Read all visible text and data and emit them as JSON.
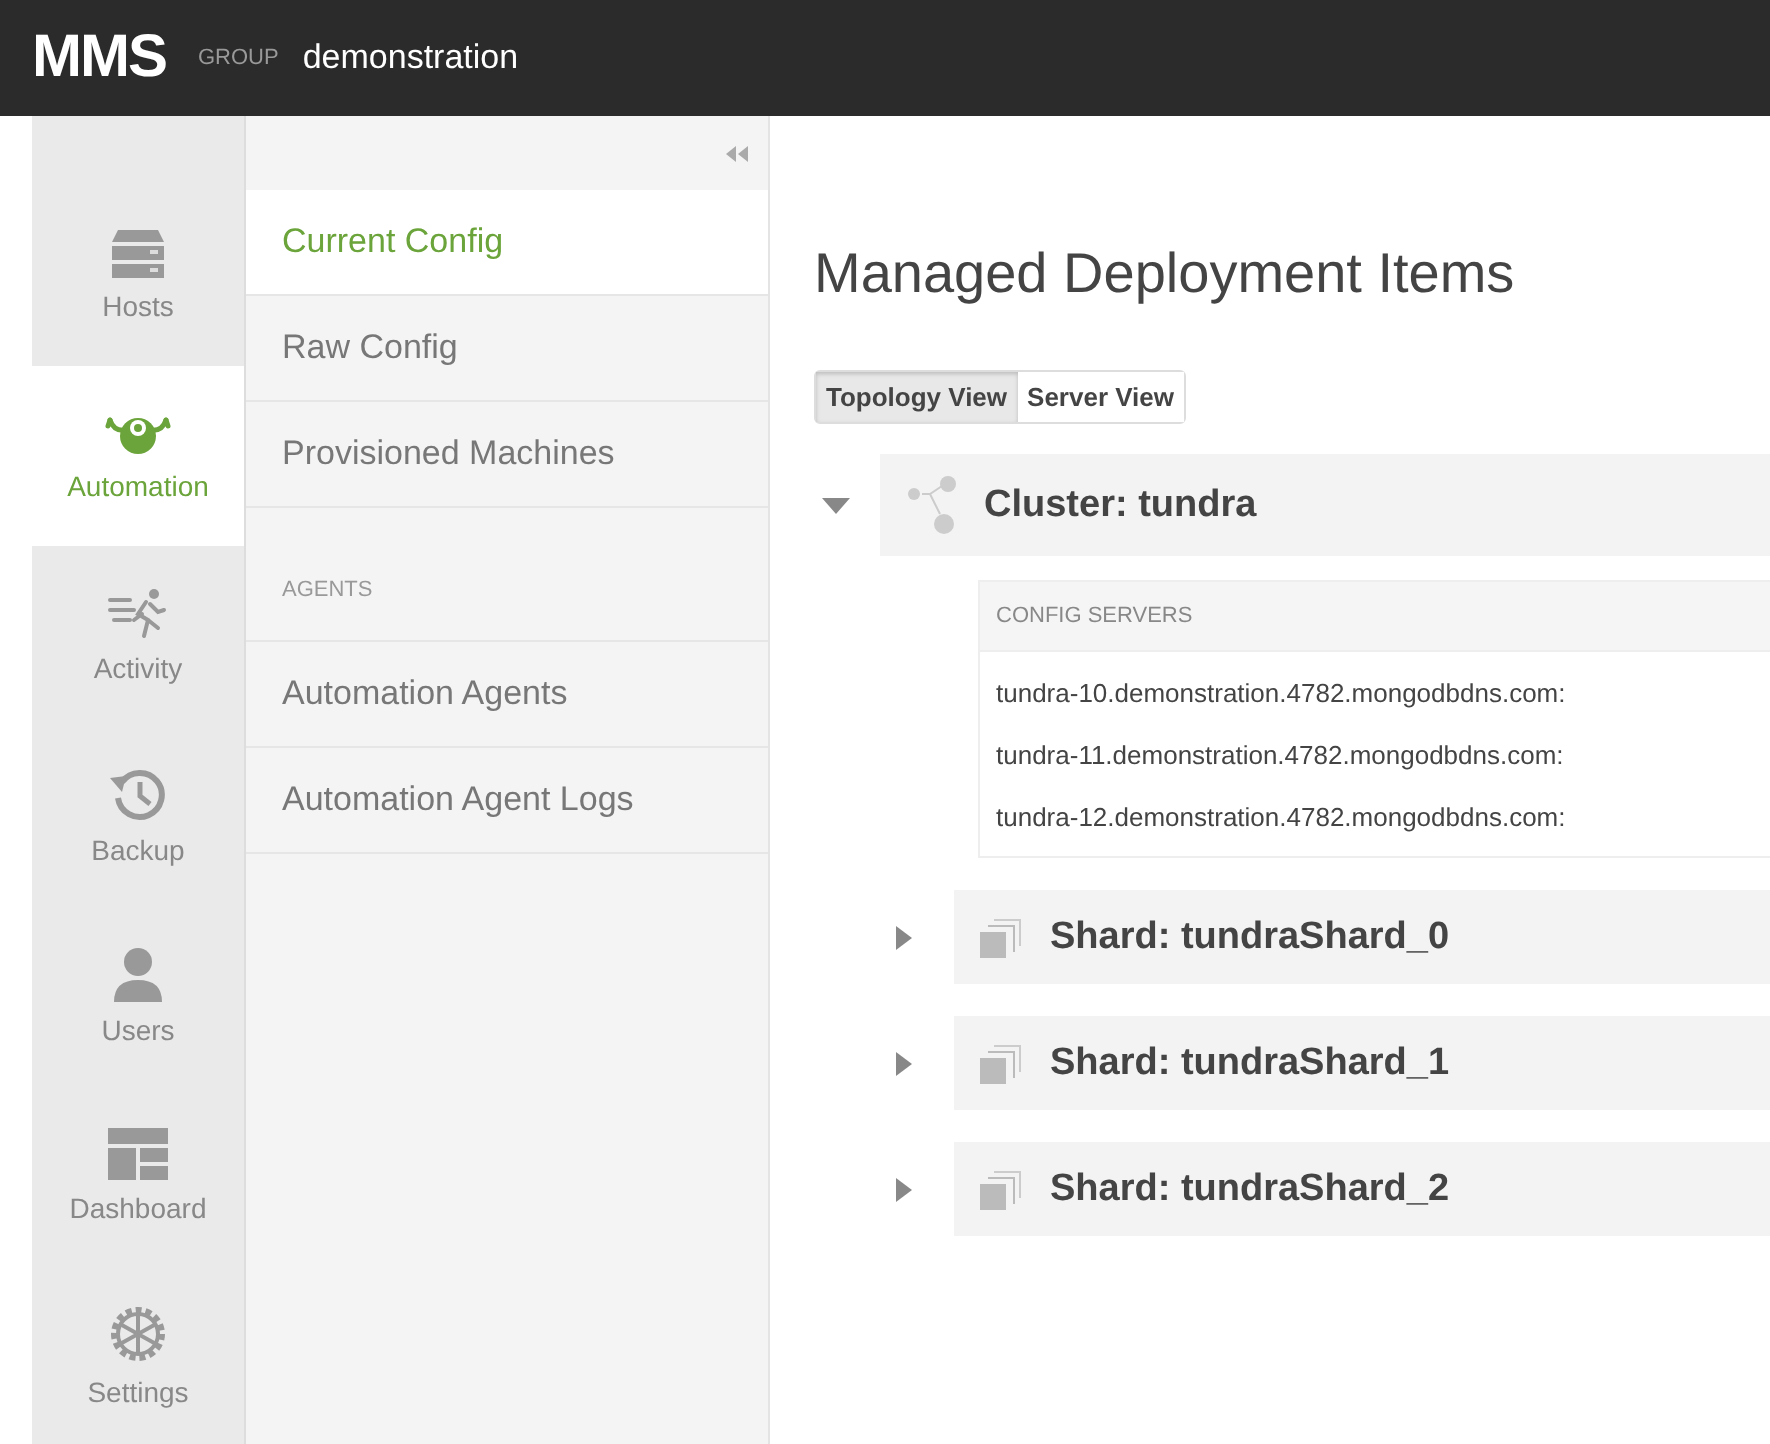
{
  "header": {
    "logo": "MMS",
    "group_label": "GROUP",
    "group_name": "demonstration"
  },
  "nav": [
    {
      "kind": "hosts",
      "label": "Hosts",
      "selected": false
    },
    {
      "kind": "automation",
      "label": "Automation",
      "selected": true
    },
    {
      "kind": "activity",
      "label": "Activity",
      "selected": false
    },
    {
      "kind": "backup",
      "label": "Backup",
      "selected": false
    },
    {
      "kind": "users",
      "label": "Users",
      "selected": false
    },
    {
      "kind": "dashboard",
      "label": "Dashboard",
      "selected": false
    },
    {
      "kind": "settings",
      "label": "Settings",
      "selected": false
    }
  ],
  "subnav": {
    "items": [
      {
        "kind": "link",
        "label": "Current Config",
        "selected": true
      },
      {
        "kind": "link",
        "label": "Raw Config",
        "selected": false
      },
      {
        "kind": "link",
        "label": "Provisioned Machines",
        "selected": false
      },
      {
        "kind": "heading",
        "label": "AGENTS"
      },
      {
        "kind": "link",
        "label": "Automation Agents",
        "selected": false
      },
      {
        "kind": "link",
        "label": "Automation Agent Logs",
        "selected": false
      }
    ]
  },
  "main": {
    "title": "Managed Deployment Items",
    "view_tabs": [
      {
        "label": "Topology View",
        "selected": true
      },
      {
        "label": "Server View",
        "selected": false
      }
    ],
    "cluster": {
      "label": "Cluster: tundra",
      "expanded": true,
      "config_servers": {
        "heading": "CONFIG SERVERS",
        "hosts": [
          "tundra-10.demonstration.4782.mongodbdns.com:",
          "tundra-11.demonstration.4782.mongodbdns.com:",
          "tundra-12.demonstration.4782.mongodbdns.com:"
        ]
      },
      "shards": [
        {
          "label": "Shard: tundraShard_0",
          "expanded": false
        },
        {
          "label": "Shard: tundraShard_1",
          "expanded": false
        },
        {
          "label": "Shard: tundraShard_2",
          "expanded": false
        }
      ]
    }
  }
}
